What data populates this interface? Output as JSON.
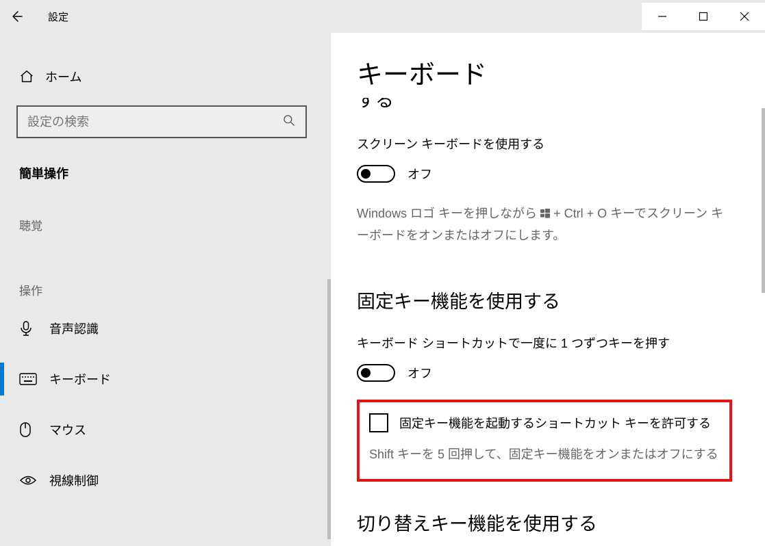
{
  "titlebar": {
    "title": "設定"
  },
  "sidebar": {
    "home": "ホーム",
    "search_placeholder": "設定の検索",
    "category": "簡単操作",
    "group_hearing": "聴覚",
    "group_interaction": "操作",
    "items": {
      "voice": "音声認識",
      "keyboard": "キーボード",
      "mouse": "マウス",
      "eye": "視線制御"
    }
  },
  "content": {
    "page_title": "キーボード",
    "cutoff_heading": "実際のキーボードを使わずにデバイスを使用する",
    "osk": {
      "label": "スクリーン キーボードを使用する",
      "state": "オフ",
      "help_a": "Windows ロゴ キーを押しながら",
      "help_b": " + Ctrl + O キーでスクリーン キーボードをオンまたはオフにします。"
    },
    "sticky": {
      "heading": "固定キー機能を使用する",
      "label": "キーボード ショートカットで一度に 1 つずつキーを押す",
      "state": "オフ",
      "checkbox_label": "固定キー機能を起動するショートカット キーを許可する",
      "hint": "Shift キーを 5 回押して、固定キー機能をオンまたはオフにする"
    },
    "toggle_keys": {
      "heading": "切り替えキー機能を使用する"
    }
  }
}
